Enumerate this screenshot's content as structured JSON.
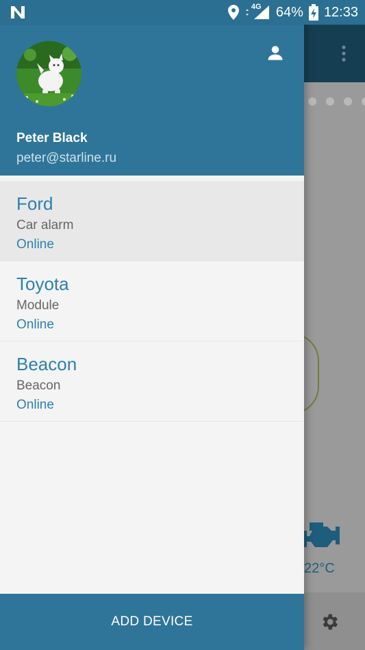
{
  "status_bar": {
    "network_label": "4G",
    "battery_percent": "64%",
    "time": "12:33",
    "icons": [
      "notification-n-icon",
      "location-icon",
      "signal-icon",
      "battery-charging-icon"
    ]
  },
  "background_app": {
    "temperature": "22°C",
    "icons": [
      "more-vert-icon",
      "engine-icon",
      "gear-icon"
    ]
  },
  "drawer": {
    "user": {
      "name": "Peter Black",
      "email": "peter@starline.ru"
    },
    "devices": [
      {
        "name": "Ford",
        "type": "Car alarm",
        "status": "Online",
        "selected": true
      },
      {
        "name": "Toyota",
        "type": "Module",
        "status": "Online",
        "selected": false
      },
      {
        "name": "Beacon",
        "type": "Beacon",
        "status": "Online",
        "selected": false
      }
    ],
    "add_device_label": "ADD DEVICE"
  },
  "colors": {
    "accent": "#2f7599",
    "link": "#2d80ad",
    "toolbar_dark": "#163e53"
  }
}
